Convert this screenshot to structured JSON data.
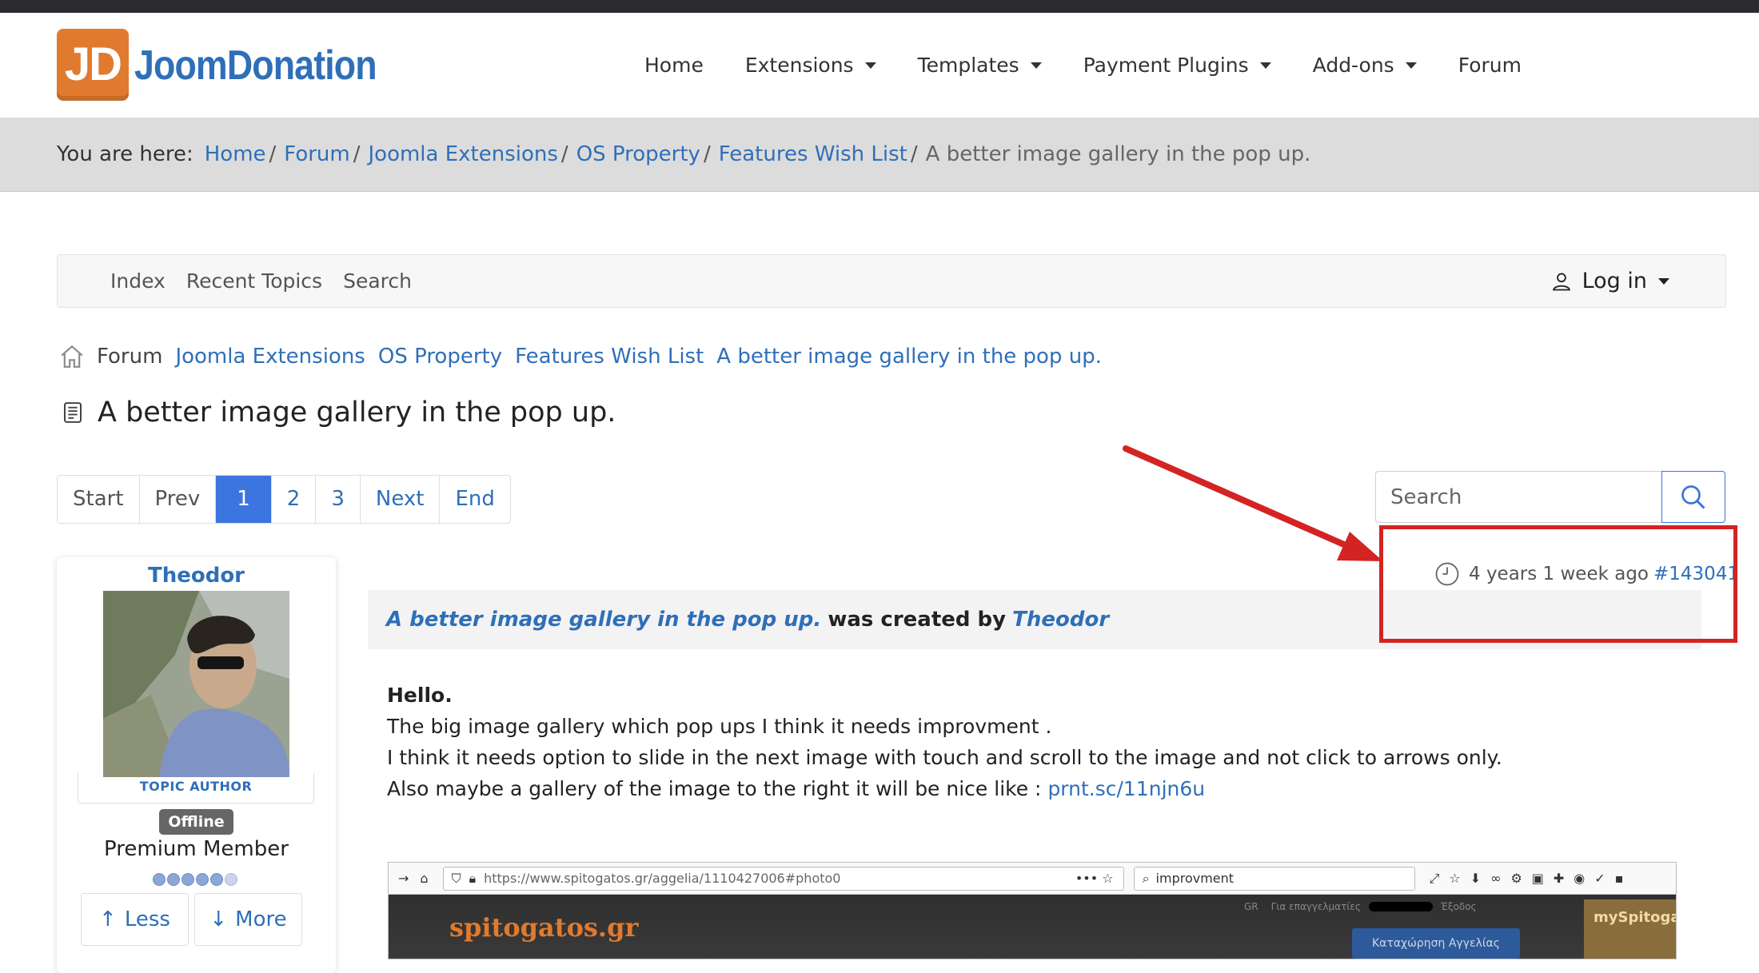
{
  "header": {
    "logo_mark": "JD",
    "logo_text": "JoomDonation",
    "nav": [
      {
        "label": "Home"
      },
      {
        "label": "Extensions"
      },
      {
        "label": "Templates"
      },
      {
        "label": "Payment Plugins"
      },
      {
        "label": "Add-ons"
      },
      {
        "label": "Forum"
      }
    ]
  },
  "breadcrumb": {
    "lead": "You are here:",
    "links": [
      "Home",
      "Forum",
      "Joomla Extensions",
      "OS Property",
      "Features Wish List"
    ],
    "current": "A better image gallery in the pop up."
  },
  "forum_menu": {
    "items": [
      "Index",
      "Recent Topics",
      "Search"
    ],
    "login": "Log in"
  },
  "page_breadcrumb": {
    "root": "Forum",
    "links": [
      "Joomla Extensions",
      "OS Property",
      "Features Wish List",
      "A better image gallery in the pop up."
    ]
  },
  "topic": {
    "title": "A better image gallery in the pop up."
  },
  "pagination": {
    "start": "Start",
    "prev": "Prev",
    "pages": [
      "1",
      "2",
      "3"
    ],
    "current": "1",
    "next": "Next",
    "end": "End"
  },
  "topic_search": {
    "placeholder": "Search"
  },
  "author": {
    "name": "Theodor",
    "role": "TOPIC AUTHOR",
    "status": "Offline",
    "rank": "Premium Member",
    "rank_dots": 5,
    "less_label": "Less",
    "more_label": "More"
  },
  "post": {
    "time": "4 years 1 week ago",
    "id": "#143041",
    "subject": "A better image gallery in the pop up.",
    "created_by_text": "was created by",
    "author": "Theodor",
    "lines": [
      "Hello.",
      "The big image gallery which pop ups I think it needs improvment .",
      "I think it needs option to slide in the next image with touch and scroll to the image and not click to arrows only.",
      "Also maybe a gallery of the image to the right it will be nice like :"
    ],
    "link": "prnt.sc/11njn6u"
  },
  "embedded_screenshot": {
    "url": "https://www.spitogatos.gr/aggelia/1110427006#photo0",
    "search_value": "improvment",
    "brand": "spitogatos.gr",
    "cta": "Καταχώρηση Αγγελίας",
    "my_label": "mySpitoga",
    "top_links": [
      "GR",
      "Για επαγγελματίες",
      "Έξοδος"
    ]
  },
  "colors": {
    "accent": "#2f6fb8",
    "active_page": "#3c74e0",
    "logo_orange": "#e07a2e",
    "annotation_red": "#d42323"
  }
}
